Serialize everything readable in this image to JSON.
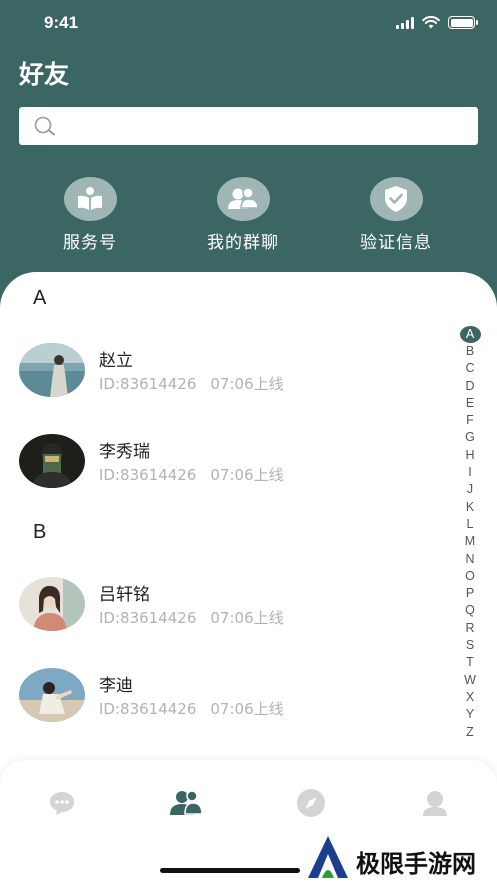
{
  "status": {
    "time": "9:41"
  },
  "header": {
    "title": "好友"
  },
  "search": {
    "placeholder": ""
  },
  "quick_actions": [
    {
      "label": "服务号",
      "icon": "book-icon"
    },
    {
      "label": "我的群聊",
      "icon": "group-icon"
    },
    {
      "label": "验证信息",
      "icon": "shield-check-icon"
    }
  ],
  "sections": [
    {
      "letter": "A",
      "contacts": [
        {
          "name": "赵立",
          "id": "ID:83614426",
          "time": "07:06上线"
        },
        {
          "name": "李秀瑞",
          "id": "ID:83614426",
          "time": "07:06上线"
        }
      ]
    },
    {
      "letter": "B",
      "contacts": [
        {
          "name": "吕轩铭",
          "id": "ID:83614426",
          "time": "07:06上线"
        },
        {
          "name": "李迪",
          "id": "ID:83614426",
          "time": "07:06上线"
        }
      ]
    }
  ],
  "alpha_index": {
    "active": "A",
    "letters": [
      "A",
      "B",
      "C",
      "D",
      "E",
      "F",
      "G",
      "H",
      "I",
      "J",
      "K",
      "L",
      "M",
      "N",
      "O",
      "P",
      "Q",
      "R",
      "S",
      "T",
      "W",
      "X",
      "Y",
      "Z"
    ]
  },
  "tabbar": {
    "tabs": [
      {
        "icon": "chat-bubble-icon",
        "active": false
      },
      {
        "icon": "contacts-icon",
        "active": true
      },
      {
        "icon": "compass-icon",
        "active": false
      },
      {
        "icon": "profile-icon",
        "active": false
      }
    ]
  },
  "watermark": {
    "text": "极限手游网"
  },
  "colors": {
    "brand": "#3c6664",
    "icon_bg": "#9fb6b4",
    "muted": "#b2b2b2",
    "tab_inactive": "#d4d4d4"
  }
}
